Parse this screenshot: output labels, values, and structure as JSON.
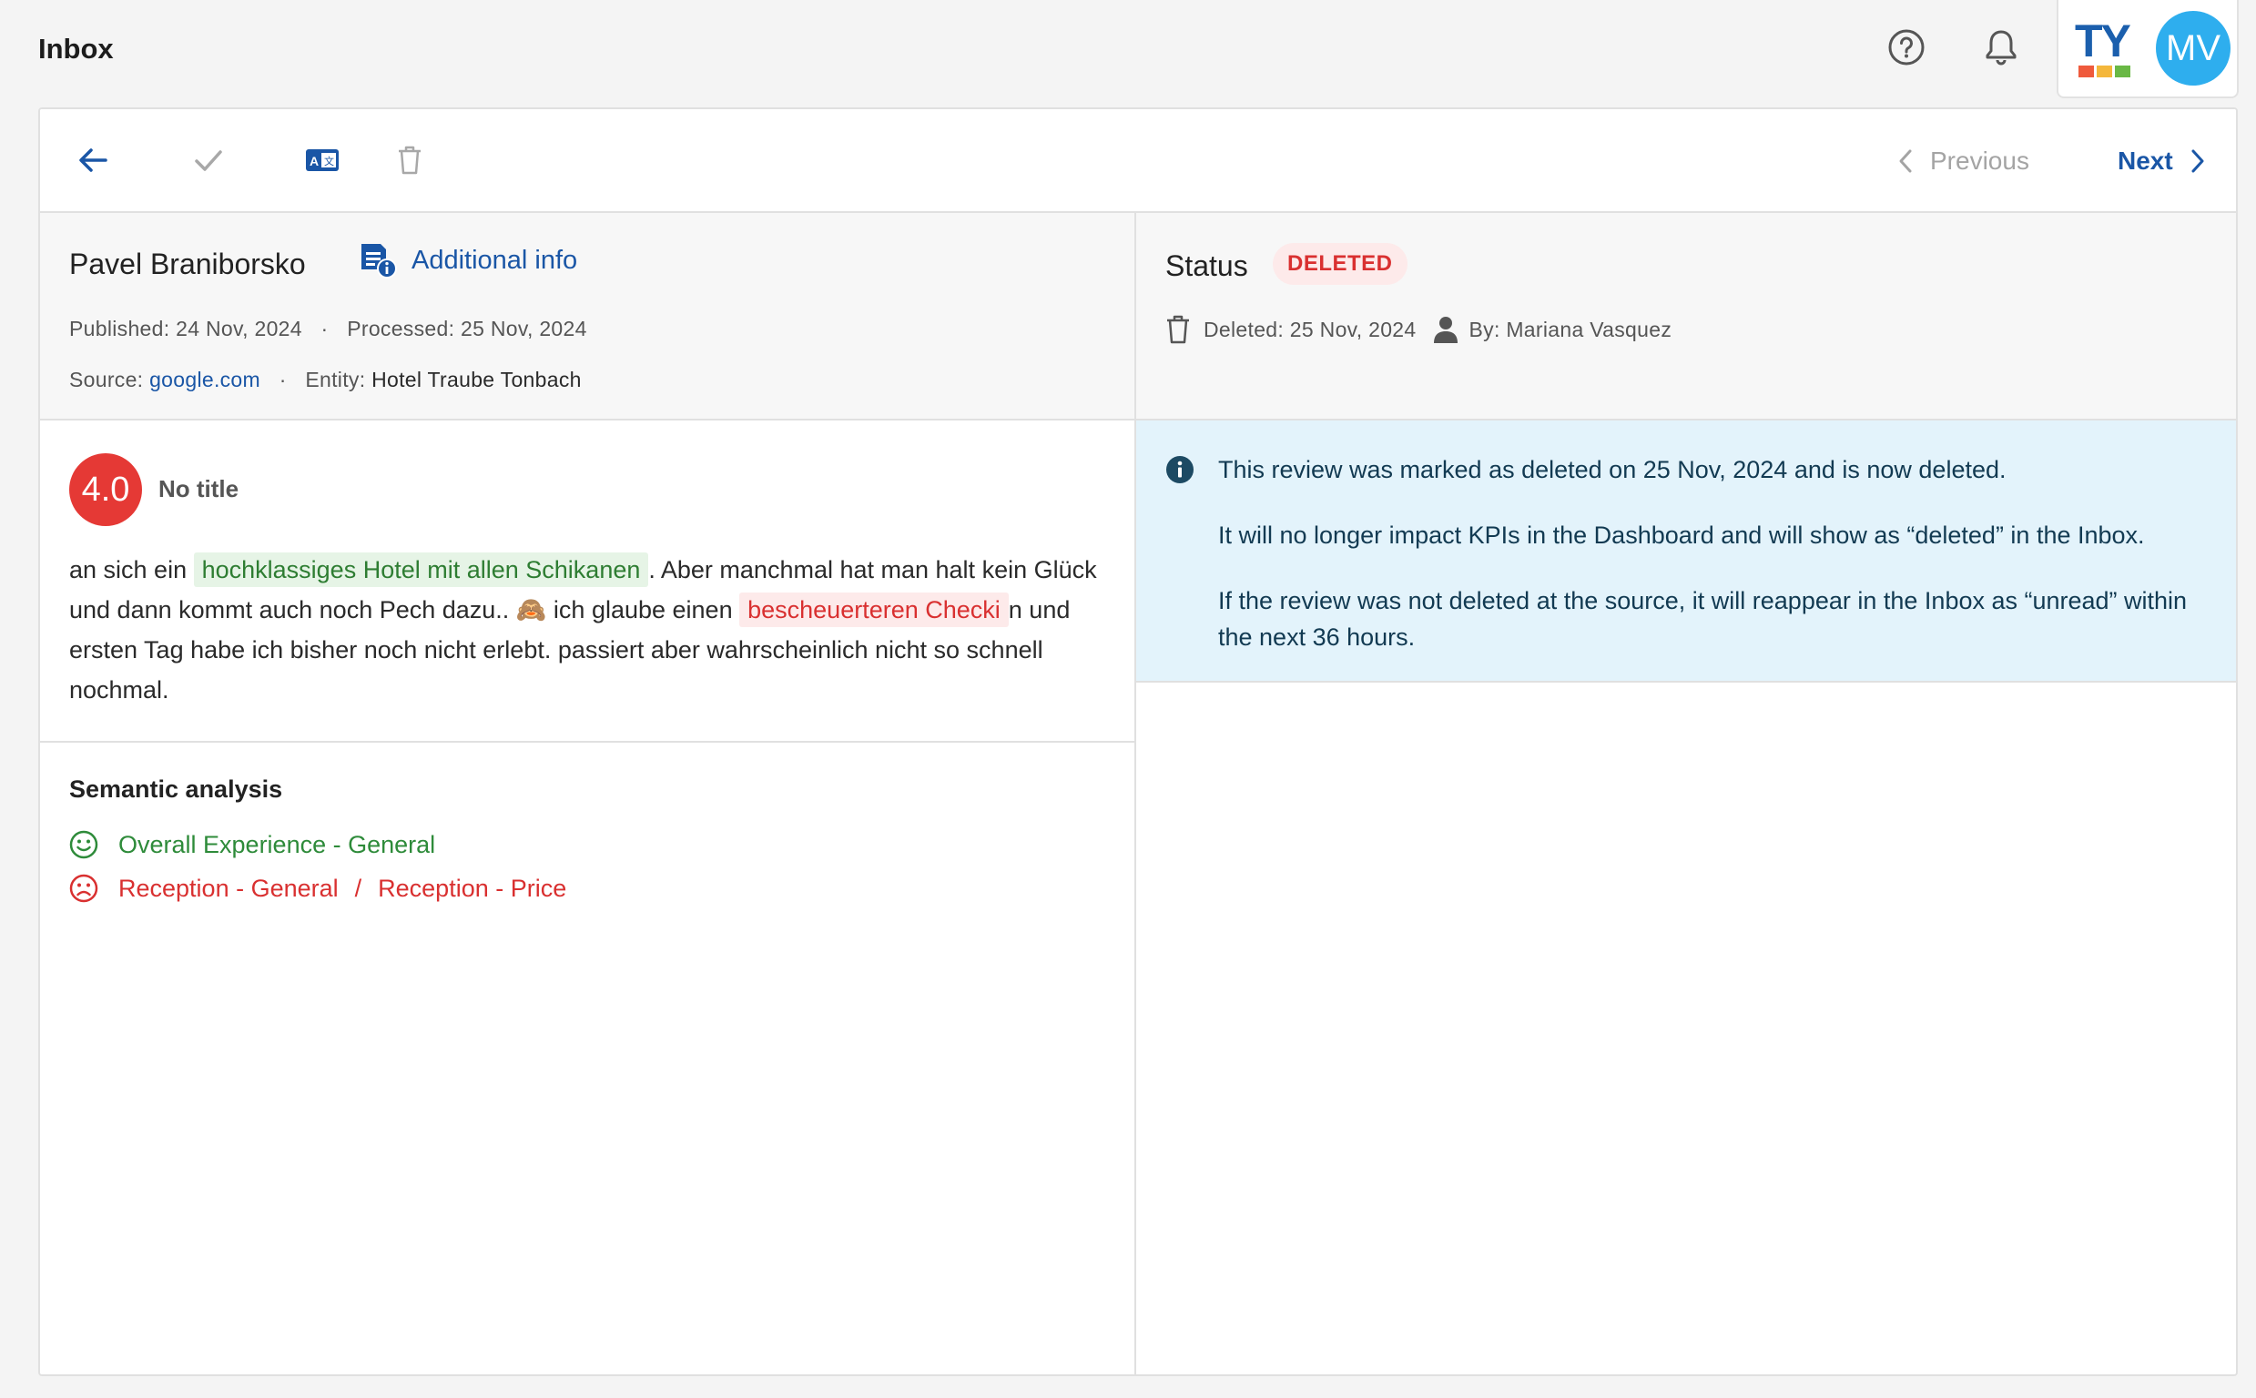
{
  "header": {
    "title": "Inbox",
    "logo_text": "TY",
    "avatar_initials": "MV",
    "icons": [
      "help-icon",
      "bell-icon"
    ]
  },
  "toolbar": {
    "icons": [
      "back-arrow-icon",
      "check-icon",
      "translate-icon",
      "trash-icon"
    ],
    "previous_label": "Previous",
    "next_label": "Next"
  },
  "review": {
    "author": "Pavel Braniborsko",
    "additional_info_label": "Additional info",
    "published_label": "Published:",
    "published_date": "24 Nov, 2024",
    "processed_label": "Processed:",
    "processed_date": "25 Nov, 2024",
    "source_label": "Source:",
    "source": "google.com",
    "entity_label": "Entity:",
    "entity": "Hotel Traube Tonbach",
    "rating": "4.0",
    "title": "No title",
    "text_1": "an sich ein",
    "highlight_positive": "hochklassiges Hotel mit allen Schikanen",
    "text_2": ". Aber manchmal hat man halt kein Glück und dann kommt auch noch Pech dazu.. 🙈 ich glaube einen",
    "highlight_negative": "bescheuerteren Checki",
    "text_3": "n und ersten Tag habe ich bisher noch nicht erlebt. passiert aber wahrscheinlich nicht so schnell nochmal."
  },
  "semantic": {
    "title": "Semantic analysis",
    "positive": [
      "Overall Experience - General"
    ],
    "negative": [
      "Reception - General",
      "Reception - Price"
    ],
    "separator": "/"
  },
  "status": {
    "label": "Status",
    "badge": "DELETED",
    "deleted_label": "Deleted:",
    "deleted_date": "25 Nov, 2024",
    "by_label": "By:",
    "by_user": "Mariana Vasquez"
  },
  "info_box": {
    "line1": "This review was marked as deleted on 25 Nov, 2024 and is now deleted.",
    "line2": "It will no longer impact KPIs in the Dashboard and will show as “deleted” in the Inbox.",
    "line3": "If the review was not deleted at the source, it will reappear in the Inbox as “unread” within the next 36 hours."
  },
  "colors": {
    "accent_blue": "#1a56a6",
    "deleted_red": "#d93030",
    "positive_green": "#2e8b3a",
    "info_bg": "#e3f3fb",
    "avatar_bg": "#2eaeee"
  }
}
